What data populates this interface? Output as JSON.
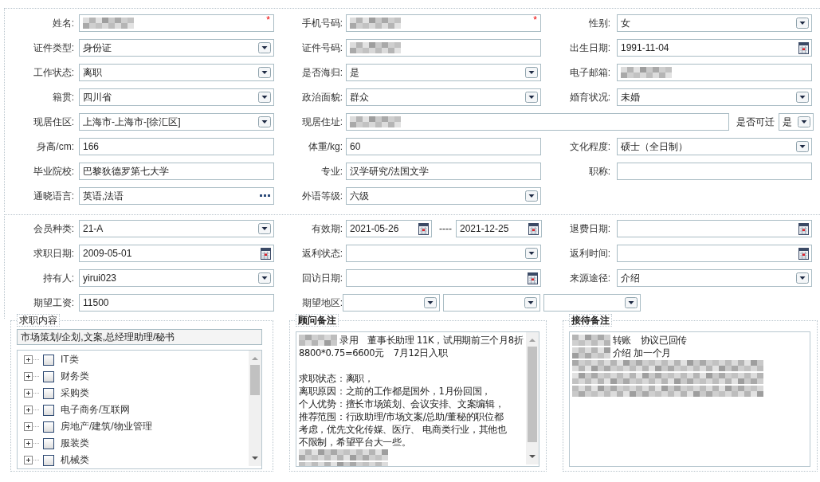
{
  "sections": [
    {
      "rows": [
        [
          {
            "label": "姓名:",
            "kind": "single",
            "fields": [
              {
                "kind": "text",
                "redacted": true,
                "required_mark": "*"
              }
            ]
          },
          {
            "label": "手机号码:",
            "kind": "single",
            "fields": [
              {
                "kind": "text",
                "redacted": true,
                "required_mark": "*"
              }
            ]
          },
          {
            "label": "性别:",
            "kind": "single",
            "fields": [
              {
                "kind": "select",
                "value": "女"
              }
            ]
          }
        ],
        [
          {
            "label": "证件类型:",
            "kind": "single",
            "fields": [
              {
                "kind": "select",
                "value": "身份证"
              }
            ]
          },
          {
            "label": "证件号码:",
            "kind": "single",
            "fields": [
              {
                "kind": "text",
                "redacted": true
              }
            ]
          },
          {
            "label": "出生日期:",
            "kind": "single",
            "fields": [
              {
                "kind": "date",
                "value": "1991-11-04"
              }
            ]
          }
        ],
        [
          {
            "label": "工作状态:",
            "kind": "single",
            "fields": [
              {
                "kind": "select",
                "value": "离职"
              }
            ]
          },
          {
            "label": "是否海归:",
            "kind": "single",
            "fields": [
              {
                "kind": "select",
                "value": "是"
              }
            ]
          },
          {
            "label": "电子邮箱:",
            "kind": "single",
            "fields": [
              {
                "kind": "text",
                "redacted": true
              }
            ]
          }
        ],
        [
          {
            "label": "籍贯:",
            "kind": "single",
            "fields": [
              {
                "kind": "select",
                "value": "四川省"
              }
            ]
          },
          {
            "label": "政治面貌:",
            "kind": "single",
            "fields": [
              {
                "kind": "select",
                "value": "群众"
              }
            ]
          },
          {
            "label": "婚育状况:",
            "kind": "single",
            "fields": [
              {
                "kind": "select",
                "value": "未婚"
              }
            ]
          }
        ],
        [
          {
            "label": "现居住区:",
            "kind": "single",
            "fields": [
              {
                "kind": "select",
                "value": "上海市-上海市-[徐汇区]"
              }
            ]
          },
          {
            "label": "现居住址:",
            "kind": "address",
            "fields": [
              {
                "kind": "text",
                "redacted": true
              },
              {
                "kind": "select",
                "prefix": "是否可迁",
                "value": "是"
              }
            ]
          }
        ],
        [
          {
            "label": "身高/cm:",
            "kind": "single",
            "fields": [
              {
                "kind": "text",
                "value": "166"
              }
            ]
          },
          {
            "label": "体重/kg:",
            "kind": "single",
            "fields": [
              {
                "kind": "text",
                "value": "60"
              }
            ]
          },
          {
            "label": "文化程度:",
            "kind": "single",
            "fields": [
              {
                "kind": "select",
                "value": "硕士（全日制）"
              }
            ]
          }
        ],
        [
          {
            "label": "毕业院校:",
            "kind": "single",
            "fields": [
              {
                "kind": "text",
                "value": "巴黎狄德罗第七大学"
              }
            ]
          },
          {
            "label": "专业:",
            "kind": "single",
            "fields": [
              {
                "kind": "text",
                "value": "汉学研究/法国文学"
              }
            ]
          },
          {
            "label": "职称:",
            "kind": "single",
            "fields": [
              {
                "kind": "text"
              }
            ]
          }
        ],
        [
          {
            "label": "通晓语言:",
            "kind": "single",
            "fields": [
              {
                "kind": "picker",
                "value": "英语,法语"
              }
            ]
          },
          {
            "label": "外语等级:",
            "kind": "single",
            "fields": [
              {
                "kind": "select",
                "value": "六级"
              }
            ]
          }
        ]
      ]
    },
    {
      "rows": [
        [
          {
            "label": "会员种类:",
            "kind": "single",
            "fields": [
              {
                "kind": "select",
                "value": "21-A"
              }
            ]
          },
          {
            "label": "有效期:",
            "kind": "range",
            "fields": [
              {
                "kind": "date",
                "value": "2021-05-26"
              },
              {
                "kind": "date",
                "prefix": "----",
                "value": "2021-12-25"
              }
            ]
          },
          {
            "label": "退费日期:",
            "kind": "single",
            "fields": [
              {
                "kind": "date"
              }
            ]
          }
        ],
        [
          {
            "label": "求职日期:",
            "kind": "single",
            "fields": [
              {
                "kind": "date",
                "value": "2009-05-01"
              }
            ]
          },
          {
            "label": "返利状态:",
            "kind": "single",
            "fields": [
              {
                "kind": "select"
              }
            ]
          },
          {
            "label": "返利时间:",
            "kind": "single",
            "fields": [
              {
                "kind": "date"
              }
            ]
          }
        ],
        [
          {
            "label": "持有人:",
            "kind": "single",
            "fields": [
              {
                "kind": "select",
                "value": "yirui023"
              }
            ]
          },
          {
            "label": "回访日期:",
            "kind": "single",
            "fields": [
              {
                "kind": "date"
              }
            ]
          },
          {
            "label": "来源途径:",
            "kind": "single",
            "fields": [
              {
                "kind": "select",
                "value": "介绍"
              }
            ]
          }
        ],
        [
          {
            "label": "期望工资:",
            "kind": "single",
            "fields": [
              {
                "kind": "text",
                "value": "11500"
              }
            ]
          },
          {
            "label": "期望地区:",
            "kind": "multi",
            "fields": [
              {
                "kind": "select"
              },
              {
                "kind": "select"
              },
              {
                "kind": "select"
              }
            ]
          }
        ]
      ]
    }
  ],
  "job_content": {
    "title": "求职内容",
    "selection": "市场策划/企划,文案,总经理助理/秘书",
    "tree": [
      {
        "label": "IT类",
        "expanded": false,
        "checked": false
      },
      {
        "label": "财务类",
        "expanded": false,
        "checked": false
      },
      {
        "label": "采购类",
        "expanded": false,
        "checked": false
      },
      {
        "label": "电子商务/互联网",
        "expanded": false,
        "checked": false
      },
      {
        "label": "房地产/建筑/物业管理",
        "expanded": false,
        "checked": false
      },
      {
        "label": "服装类",
        "expanded": false,
        "checked": false
      },
      {
        "label": "机械类",
        "expanded": false,
        "checked": false
      }
    ]
  },
  "notes": [
    {
      "title": "顾问备注",
      "scrollbar": true,
      "lines": [
        {
          "blur": true,
          "text": "录用　董事长助理 11K，试用期前三个月8折"
        },
        {
          "text": "8800*0.75=6600元　7月12日入职"
        },
        {
          "text": "求职状态：离职，",
          "gap_before": true
        },
        {
          "text": "离职原因：之前的工作都是国外，1月份回国，"
        },
        {
          "text": "个人优势：擅长市场策划、会议安排、文案编辑，"
        },
        {
          "text": "推荐范围：行政助理/市场文案/总助/董秘的职位都"
        },
        {
          "text": "考虑，优先文化传媒、医疗、 电商类行业，其他也"
        },
        {
          "text": "不限制，希望平台大一些。"
        },
        {
          "blur": true
        },
        {
          "blur": true
        }
      ]
    },
    {
      "title": "接待备注",
      "scrollbar": false,
      "lines": [
        {
          "blur": true,
          "text": "转账　协议已回传"
        },
        {
          "blur": true,
          "text": "介绍 加一个月"
        },
        {
          "blur": true
        },
        {
          "blur": true
        },
        {
          "blur": true
        }
      ]
    }
  ]
}
